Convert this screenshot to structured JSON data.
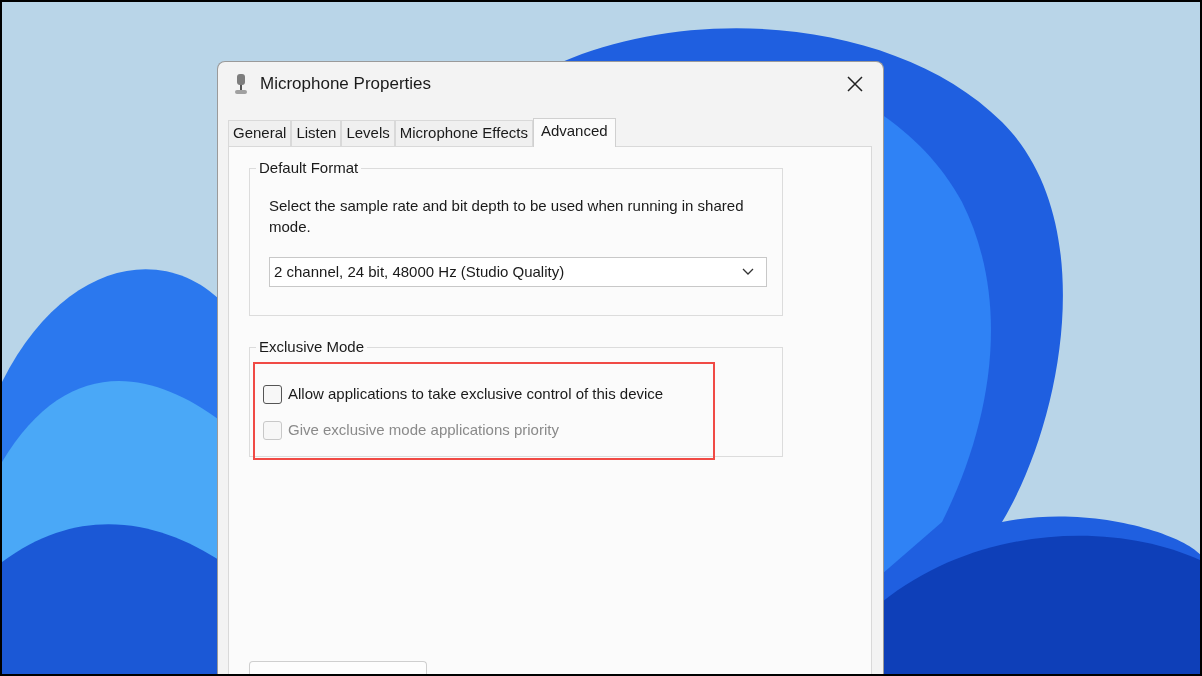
{
  "window": {
    "title": "Microphone Properties"
  },
  "tabs": [
    {
      "label": "General",
      "selected": false
    },
    {
      "label": "Listen",
      "selected": false
    },
    {
      "label": "Levels",
      "selected": false
    },
    {
      "label": "Microphone Effects",
      "selected": false
    },
    {
      "label": "Advanced",
      "selected": true
    }
  ],
  "default_format": {
    "title": "Default Format",
    "description": "Select the sample rate and bit depth to be used when running in shared mode.",
    "format": "2 channel, 24 bit, 48000 Hz (Studio Quality)"
  },
  "exclusive_mode": {
    "title": "Exclusive Mode",
    "highlighted": true,
    "options": [
      {
        "label": "Allow applications to take exclusive control of this device",
        "checked": false,
        "disabled": false
      },
      {
        "label": "Give exclusive mode applications priority",
        "checked": false,
        "disabled": true
      }
    ]
  }
}
